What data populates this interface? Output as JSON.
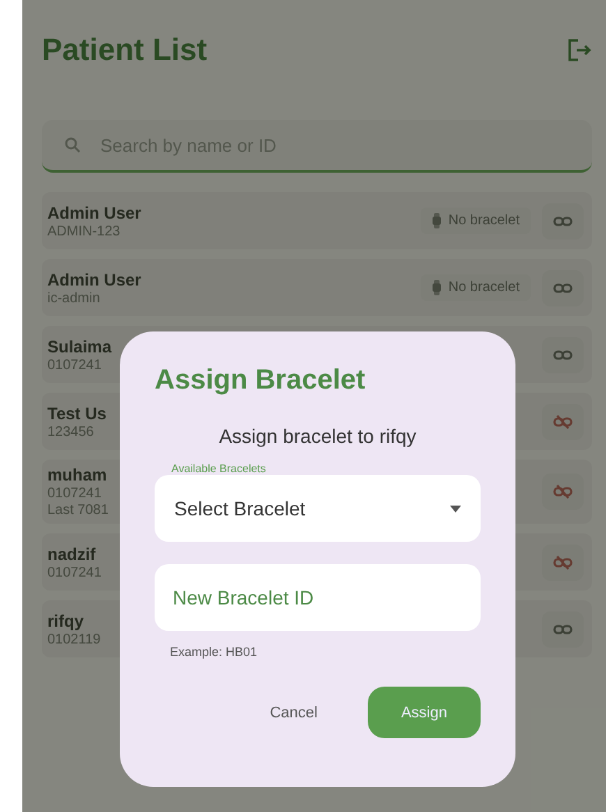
{
  "header": {
    "title": "Patient List"
  },
  "search": {
    "placeholder": "Search by name or ID"
  },
  "patients": [
    {
      "name": "Admin User",
      "details": [
        "ADMIN-123"
      ],
      "bracelet": "No bracelet",
      "assigned": false
    },
    {
      "name": "Admin User",
      "details": [
        "ic-admin"
      ],
      "bracelet": "No bracelet",
      "assigned": false
    },
    {
      "name": "Sulaima",
      "details": [
        "0107241"
      ],
      "assigned": false
    },
    {
      "name": "Test Us",
      "details": [
        "123456"
      ],
      "assigned": true
    },
    {
      "name": "muham",
      "details": [
        "0107241",
        "Last 7081"
      ],
      "assigned": true
    },
    {
      "name": "nadzif",
      "details": [
        "0107241"
      ],
      "assigned": true
    },
    {
      "name": "rifqy",
      "details": [
        "0102119"
      ],
      "assigned": false
    }
  ],
  "dialog": {
    "title": "Assign Bracelet",
    "message": "Assign bracelet to rifqy",
    "dropdown": {
      "label": "Available Bracelets",
      "value": "Select Bracelet"
    },
    "new_id": {
      "placeholder": "New Bracelet ID",
      "helper": "Example: HB01"
    },
    "buttons": [
      {
        "label": "Cancel",
        "kind": "text"
      },
      {
        "label": "Assign",
        "kind": "filled"
      }
    ]
  }
}
